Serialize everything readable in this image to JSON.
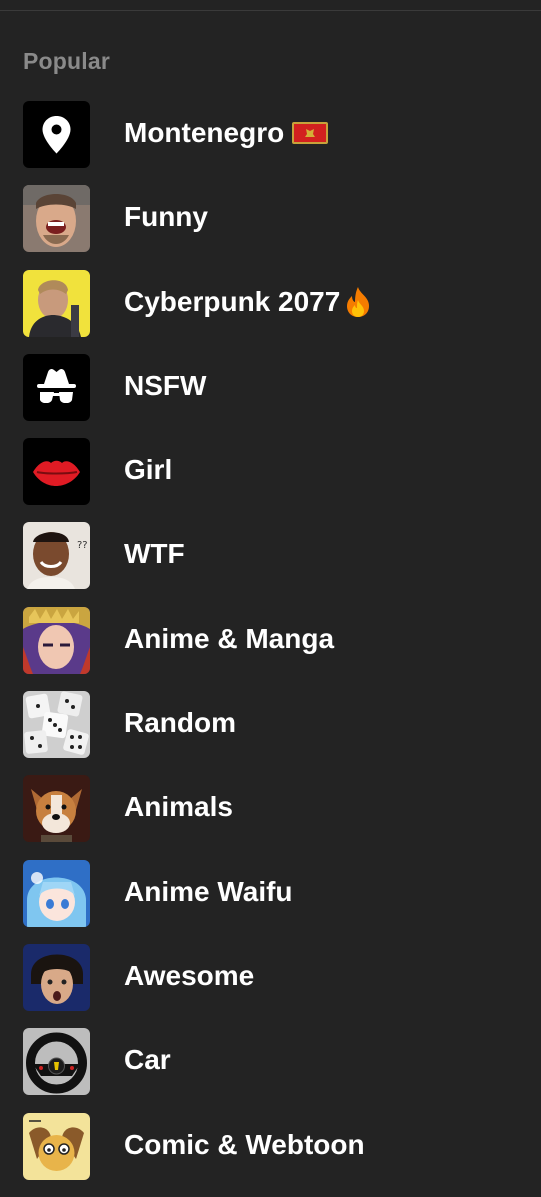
{
  "section": {
    "title": "Popular"
  },
  "items": [
    {
      "label": "Montenegro",
      "icon": "location-pin-icon",
      "emoji": "montenegro-flag-icon"
    },
    {
      "label": "Funny",
      "icon": "laughing-man-photo"
    },
    {
      "label": "Cyberpunk 2077",
      "icon": "cyberpunk-character-photo",
      "emoji": "fire-icon"
    },
    {
      "label": "NSFW",
      "icon": "incognito-hat-glasses-icon"
    },
    {
      "label": "Girl",
      "icon": "red-lips-icon"
    },
    {
      "label": "WTF",
      "icon": "confused-man-photo"
    },
    {
      "label": "Anime & Manga",
      "icon": "anime-character-photo"
    },
    {
      "label": "Random",
      "icon": "dice-photo"
    },
    {
      "label": "Animals",
      "icon": "dog-photo"
    },
    {
      "label": "Anime Waifu",
      "icon": "anime-girl-photo"
    },
    {
      "label": "Awesome",
      "icon": "surprised-man-photo"
    },
    {
      "label": "Car",
      "icon": "steering-wheel-photo"
    },
    {
      "label": "Comic & Webtoon",
      "icon": "cartoon-dog-photo"
    }
  ],
  "colors": {
    "background": "#232323",
    "section_title": "#8a8a8a",
    "label": "#ffffff"
  }
}
